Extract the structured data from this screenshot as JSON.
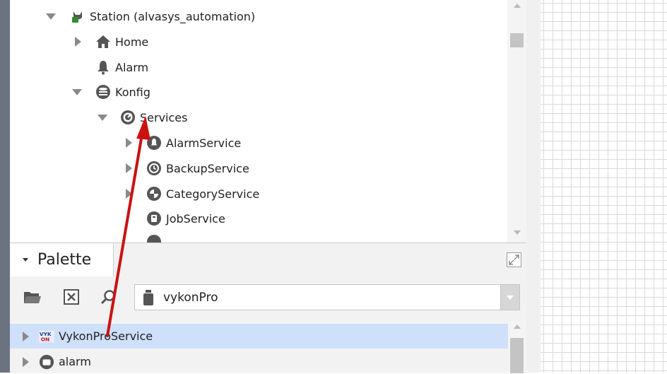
{
  "nav_tree": {
    "items": [
      {
        "label": "Station (alvasys_automation)",
        "icon": "station-icon",
        "expander": "expanded"
      },
      {
        "label": "Home",
        "icon": "home-icon",
        "expander": "collapsed"
      },
      {
        "label": "Alarm",
        "icon": "bell-icon",
        "expander": "none"
      },
      {
        "label": "Konfig",
        "icon": "database-icon",
        "expander": "expanded"
      },
      {
        "label": "Services",
        "icon": "services-icon",
        "expander": "expanded"
      },
      {
        "label": "AlarmService",
        "icon": "alarm-service-icon",
        "expander": "collapsed"
      },
      {
        "label": "BackupService",
        "icon": "backup-service-icon",
        "expander": "collapsed"
      },
      {
        "label": "CategoryService",
        "icon": "category-service-icon",
        "expander": "collapsed"
      },
      {
        "label": "JobService",
        "icon": "job-service-icon",
        "expander": "none"
      }
    ]
  },
  "palette": {
    "title": "Palette",
    "toolbar": {
      "open_icon": "folder-open-icon",
      "close_icon": "close-box-icon",
      "find_icon": "find-icon"
    },
    "module": {
      "value": "vykonPro",
      "icon": "jar-icon"
    },
    "items": [
      {
        "label": "VykonProService",
        "icon": "vykon-logo-icon",
        "selected": true
      },
      {
        "label": "alarm",
        "icon": "module-folder-icon",
        "selected": false
      }
    ]
  },
  "annotation": {
    "type": "arrow",
    "color": "#cc1111"
  },
  "colors": {
    "selection": "#cfe0fb",
    "arrow": "#cc1111",
    "canvas_grid": "#d9d9d9"
  }
}
